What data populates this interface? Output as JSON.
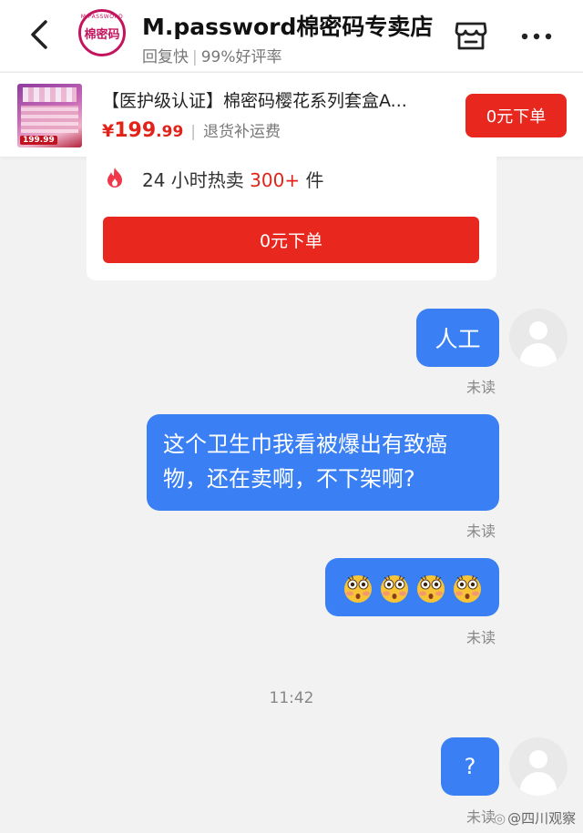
{
  "header": {
    "shop_name": "M.password棉密码专卖店",
    "reply": "回复快",
    "rating": "99%好评率",
    "logo_text": "棉密码",
    "logo_ring_text": "M.PASSWORD"
  },
  "product": {
    "title": "【医护级认证】棉密码樱花系列套盒A...",
    "price_symbol": "¥",
    "price_int": "199",
    "price_dec": ".99",
    "return_note": "退货补运费",
    "order_button": "0元下单",
    "thumb_price": "199.99"
  },
  "card": {
    "hot_prefix": "24 小时热卖 ",
    "hot_count": "300+",
    "hot_suffix": " 件",
    "order_button": "0元下单"
  },
  "messages": [
    {
      "text": "人工",
      "status": "未读"
    },
    {
      "text": "这个卫生巾我看被爆出有致癌物，还在卖啊，不下架啊?",
      "status": "未读"
    },
    {
      "text": "",
      "status": "未读",
      "emoji": [
        "flushed-face",
        "flushed-face",
        "flushed-face",
        "flushed-face"
      ]
    },
    {
      "text": "?",
      "status": "未读"
    }
  ],
  "time": "11:42",
  "watermark": "@四川观察",
  "colors": {
    "bubble": "#3a80f4",
    "order_red": "#e8281f",
    "price_red": "#e2231a",
    "logo_magenta": "#c4145f"
  }
}
